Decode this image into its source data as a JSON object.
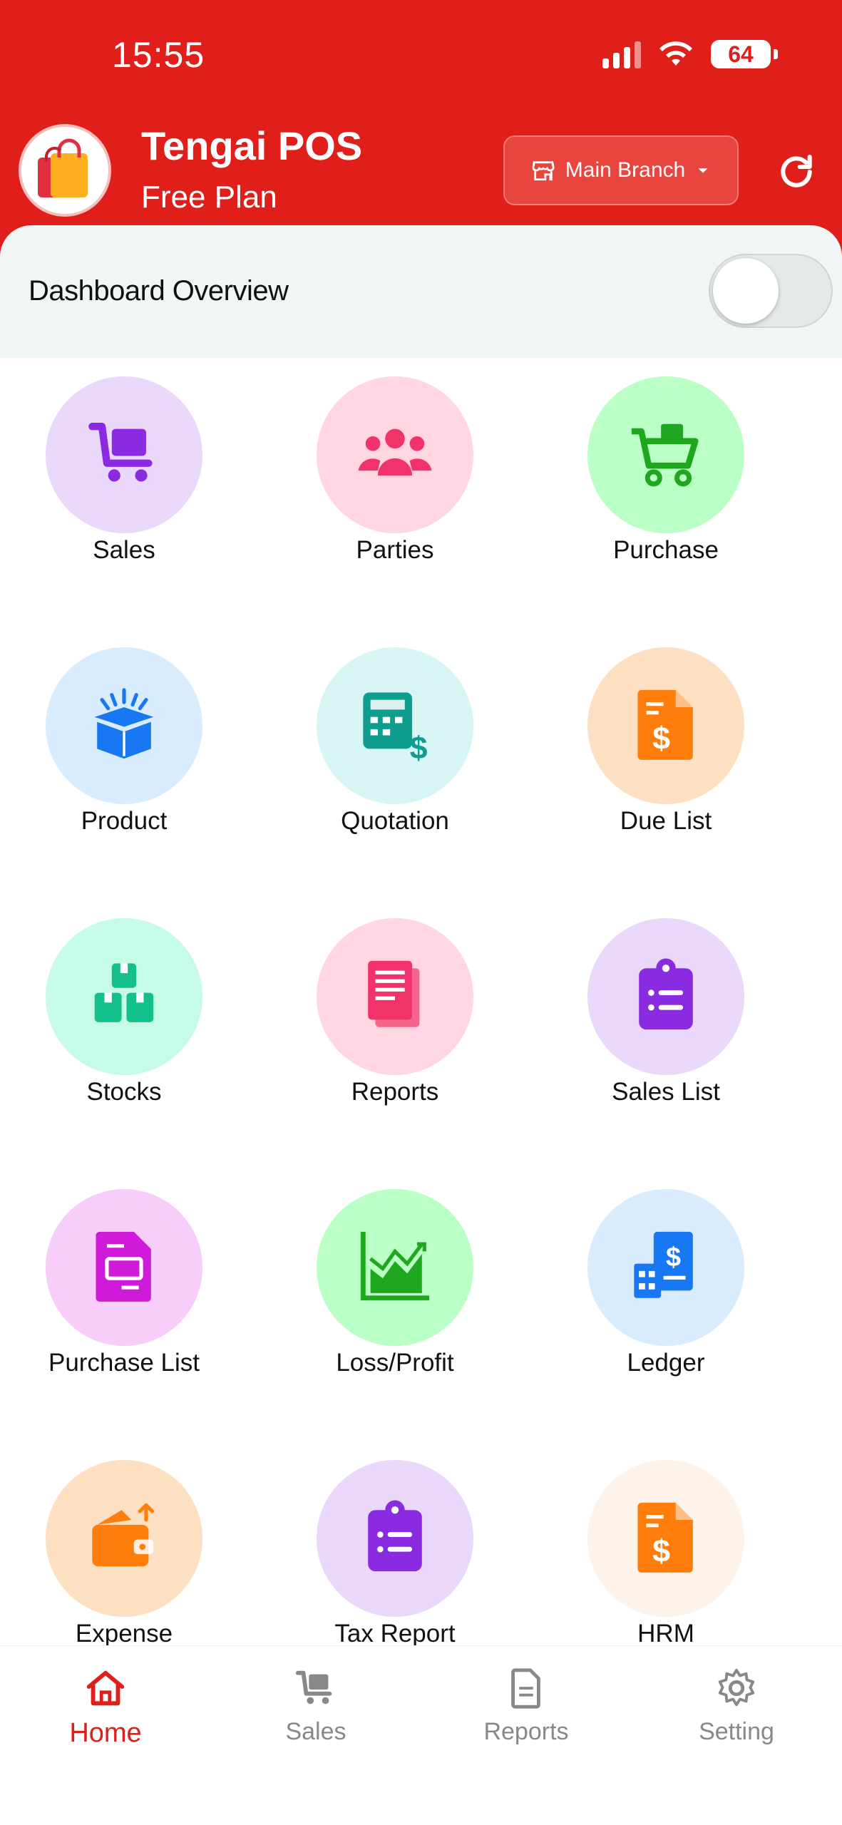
{
  "status_bar": {
    "time": "15:55",
    "battery": "64"
  },
  "header": {
    "app_name": "Tengai POS",
    "plan": "Free Plan",
    "branch_label": "Main Branch"
  },
  "overview": {
    "title": "Dashboard Overview",
    "toggle_on": false
  },
  "tiles": [
    {
      "label": "Sales",
      "icon": "cart-icon",
      "bg": "#ead8fb",
      "fg": "#8a2be2"
    },
    {
      "label": "Parties",
      "icon": "users-icon",
      "bg": "#ffd6e2",
      "fg": "#f2336b"
    },
    {
      "label": "Purchase",
      "icon": "shopping-cart-icon",
      "bg": "#baffc6",
      "fg": "#1fa81f"
    },
    {
      "label": "Product",
      "icon": "box-icon",
      "bg": "#d9ecfd",
      "fg": "#1877f2"
    },
    {
      "label": "Quotation",
      "icon": "calculator-icon",
      "bg": "#d6f5f3",
      "fg": "#0f9d8f"
    },
    {
      "label": "Due List",
      "icon": "invoice-dollar-icon",
      "bg": "#fde0c2",
      "fg": "#ff7d0a"
    },
    {
      "label": "Stocks",
      "icon": "boxes-icon",
      "bg": "#c6fbe8",
      "fg": "#13c08b"
    },
    {
      "label": "Reports",
      "icon": "documents-icon",
      "bg": "#ffd6e2",
      "fg": "#f2336b"
    },
    {
      "label": "Sales List",
      "icon": "clipboard-list-icon",
      "bg": "#ead8fb",
      "fg": "#8a2be2"
    },
    {
      "label": "Purchase List",
      "icon": "file-list-icon",
      "bg": "#f7cdfa",
      "fg": "#cf1ad9"
    },
    {
      "label": "Loss/Profit",
      "icon": "chart-area-icon",
      "bg": "#baffc6",
      "fg": "#1fa81f"
    },
    {
      "label": "Ledger",
      "icon": "ledger-icon",
      "bg": "#d9ecfd",
      "fg": "#1877f2"
    },
    {
      "label": "Expense",
      "icon": "wallet-icon",
      "bg": "#fde0c2",
      "fg": "#ff7d0a"
    },
    {
      "label": "Tax Report",
      "icon": "clipboard-list-icon",
      "bg": "#ead8fb",
      "fg": "#8a2be2"
    },
    {
      "label": "HRM",
      "icon": "invoice-dollar-icon",
      "bg": "#fdf3ea",
      "fg": "#ff7d0a"
    }
  ],
  "bottom_nav": [
    {
      "label": "Home",
      "icon": "home-icon",
      "active": true
    },
    {
      "label": "Sales",
      "icon": "cart-icon",
      "active": false
    },
    {
      "label": "Reports",
      "icon": "document-icon",
      "active": false
    },
    {
      "label": "Setting",
      "icon": "gear-icon",
      "active": false
    }
  ],
  "colors": {
    "brand": "#e01e1a",
    "inactive": "#888888"
  }
}
